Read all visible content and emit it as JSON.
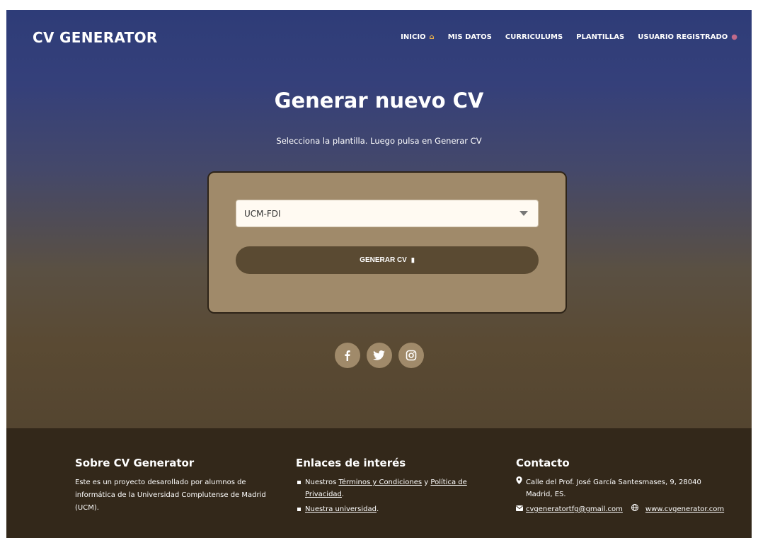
{
  "header": {
    "logo": "CV GENERATOR",
    "nav": [
      {
        "label": "INICIO",
        "icon": "home-icon"
      },
      {
        "label": "MIS DATOS"
      },
      {
        "label": "CURRICULUMS"
      },
      {
        "label": "PLANTILLAS"
      },
      {
        "label": "USUARIO REGISTRADO",
        "icon": "user-icon"
      }
    ]
  },
  "main": {
    "title": "Generar nuevo CV",
    "subtitle": "Selecciona la plantilla. Luego pulsa en Generar CV",
    "select": {
      "value": "UCM-FDI"
    },
    "generate_label": "GENERAR CV"
  },
  "socials": [
    "facebook-icon",
    "twitter-icon",
    "instagram-icon"
  ],
  "footer": {
    "about": {
      "title": "Sobre CV Generator",
      "text": "Este es un proyecto desarollado por alumnos de informática de la Universidad Complutense de Madrid (UCM)."
    },
    "links": {
      "title": "Enlaces de interés",
      "item1_prefix": "Nuestros ",
      "item1_link1": "Términos y Condiciones",
      "item1_mid": " y ",
      "item1_link2": "Política de Privacidad",
      "item1_suffix": ".",
      "item2_link": "Nuestra universidad",
      "item2_suffix": "."
    },
    "contact": {
      "title": "Contacto",
      "address": "Calle del Prof. José García Santesmases, 9, 28040 Madrid, ES.",
      "email": "cvgeneratortfg@gmail.com",
      "website": "www.cvgenerator.com"
    }
  },
  "colors": {
    "card": "#a08a6a",
    "button": "#5a4a32",
    "footer": "#33281a",
    "hero_top": "#2e3c78"
  }
}
